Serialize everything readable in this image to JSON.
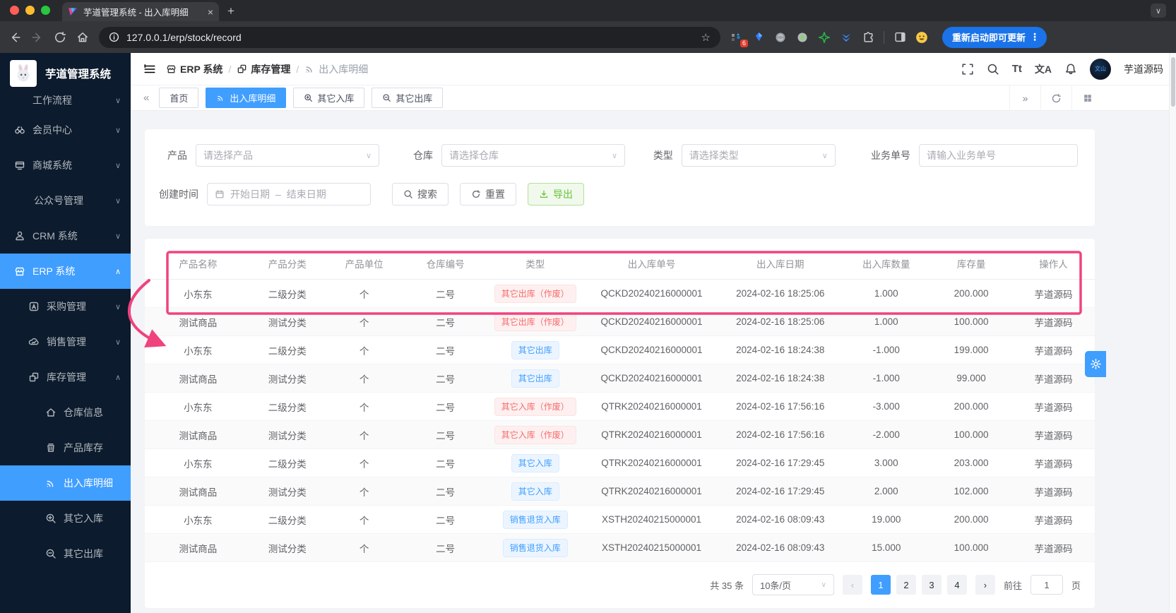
{
  "colors": {
    "accent": "#409eff",
    "danger": "#f56c6c",
    "success": "#67c23a",
    "sidebar_bg": "#0c1b2d",
    "annotation_pink": "#f0437e",
    "update_button_bg": "#1a73e8"
  },
  "glyphs": {
    "close": "×",
    "new_tab": "+",
    "strip_chevron": "∨",
    "star": "☆",
    "more_dots": "⋮",
    "chevron_down": "∨",
    "chevron_up": "∧",
    "collapse_left": "«",
    "expand_right": "»",
    "range_dash": "–",
    "prev": "‹",
    "next": "›",
    "font_size": "Tt",
    "translate": "文A"
  },
  "browser": {
    "tab_title": "芋道管理系统 - 出入库明细",
    "url": "127.0.0.1/erp/stock/record",
    "extension_badge": "6",
    "update_label": "重新启动即可更新"
  },
  "sidebar": {
    "app_title": "芋道管理系统",
    "items": [
      {
        "label": "工作流程"
      },
      {
        "label": "会员中心"
      },
      {
        "label": "商城系统"
      },
      {
        "label": "公众号管理"
      },
      {
        "label": "CRM 系统"
      },
      {
        "label": "ERP 系统"
      },
      {
        "label": "采购管理"
      },
      {
        "label": "销售管理"
      },
      {
        "label": "库存管理"
      },
      {
        "label": "仓库信息"
      },
      {
        "label": "产品库存"
      },
      {
        "label": "出入库明细"
      },
      {
        "label": "其它入库"
      },
      {
        "label": "其它出库"
      }
    ]
  },
  "header": {
    "breadcrumb": [
      {
        "label": "ERP 系统"
      },
      {
        "label": "库存管理"
      },
      {
        "label": "出入库明细"
      }
    ],
    "username": "芋道源码"
  },
  "tabs": {
    "items": [
      {
        "label": "首页"
      },
      {
        "label": "出入库明细"
      },
      {
        "label": "其它入库"
      },
      {
        "label": "其它出库"
      }
    ]
  },
  "filters": {
    "product_label": "产品",
    "product_placeholder": "请选择产品",
    "warehouse_label": "仓库",
    "warehouse_placeholder": "请选择仓库",
    "type_label": "类型",
    "type_placeholder": "请选择类型",
    "bizno_label": "业务单号",
    "bizno_placeholder": "请输入业务单号",
    "created_label": "创建时间",
    "start_placeholder": "开始日期",
    "end_placeholder": "结束日期",
    "search_label": "搜索",
    "reset_label": "重置",
    "export_label": "导出"
  },
  "table": {
    "headers": [
      "产品名称",
      "产品分类",
      "产品单位",
      "仓库编号",
      "类型",
      "出入库单号",
      "出入库日期",
      "出入库数量",
      "库存量",
      "操作人"
    ],
    "rows": [
      {
        "name": "小东东",
        "category": "二级分类",
        "unit": "个",
        "warehouse": "二号",
        "type": "其它出库（作废）",
        "type_style": "danger",
        "order_no": "QCKD20240216000001",
        "date": "2024-02-16 18:25:06",
        "qty": "1.000",
        "stock": "200.000",
        "operator": "芋道源码"
      },
      {
        "name": "测试商品",
        "category": "测试分类",
        "unit": "个",
        "warehouse": "二号",
        "type": "其它出库（作废）",
        "type_style": "danger",
        "order_no": "QCKD20240216000001",
        "date": "2024-02-16 18:25:06",
        "qty": "1.000",
        "stock": "100.000",
        "operator": "芋道源码"
      },
      {
        "name": "小东东",
        "category": "二级分类",
        "unit": "个",
        "warehouse": "二号",
        "type": "其它出库",
        "type_style": "primary",
        "order_no": "QCKD20240216000001",
        "date": "2024-02-16 18:24:38",
        "qty": "-1.000",
        "stock": "199.000",
        "operator": "芋道源码"
      },
      {
        "name": "测试商品",
        "category": "测试分类",
        "unit": "个",
        "warehouse": "二号",
        "type": "其它出库",
        "type_style": "primary",
        "order_no": "QCKD20240216000001",
        "date": "2024-02-16 18:24:38",
        "qty": "-1.000",
        "stock": "99.000",
        "operator": "芋道源码"
      },
      {
        "name": "小东东",
        "category": "二级分类",
        "unit": "个",
        "warehouse": "二号",
        "type": "其它入库（作废）",
        "type_style": "danger",
        "order_no": "QTRK20240216000001",
        "date": "2024-02-16 17:56:16",
        "qty": "-3.000",
        "stock": "200.000",
        "operator": "芋道源码"
      },
      {
        "name": "测试商品",
        "category": "测试分类",
        "unit": "个",
        "warehouse": "二号",
        "type": "其它入库（作废）",
        "type_style": "danger",
        "order_no": "QTRK20240216000001",
        "date": "2024-02-16 17:56:16",
        "qty": "-2.000",
        "stock": "100.000",
        "operator": "芋道源码"
      },
      {
        "name": "小东东",
        "category": "二级分类",
        "unit": "个",
        "warehouse": "二号",
        "type": "其它入库",
        "type_style": "primary",
        "order_no": "QTRK20240216000001",
        "date": "2024-02-16 17:29:45",
        "qty": "3.000",
        "stock": "203.000",
        "operator": "芋道源码"
      },
      {
        "name": "测试商品",
        "category": "测试分类",
        "unit": "个",
        "warehouse": "二号",
        "type": "其它入库",
        "type_style": "primary",
        "order_no": "QTRK20240216000001",
        "date": "2024-02-16 17:29:45",
        "qty": "2.000",
        "stock": "102.000",
        "operator": "芋道源码"
      },
      {
        "name": "小东东",
        "category": "二级分类",
        "unit": "个",
        "warehouse": "二号",
        "type": "销售退货入库",
        "type_style": "primary",
        "order_no": "XSTH20240215000001",
        "date": "2024-02-16 08:09:43",
        "qty": "19.000",
        "stock": "200.000",
        "operator": "芋道源码"
      },
      {
        "name": "测试商品",
        "category": "测试分类",
        "unit": "个",
        "warehouse": "二号",
        "type": "销售退货入库",
        "type_style": "primary",
        "order_no": "XSTH20240215000001",
        "date": "2024-02-16 08:09:43",
        "qty": "15.000",
        "stock": "100.000",
        "operator": "芋道源码"
      }
    ]
  },
  "pagination": {
    "total_text": "共 35 条",
    "page_size": "10条/页",
    "pages": [
      "1",
      "2",
      "3",
      "4"
    ],
    "active_page": "1",
    "goto_label": "前往",
    "goto_value": "1",
    "page_unit": "页"
  }
}
